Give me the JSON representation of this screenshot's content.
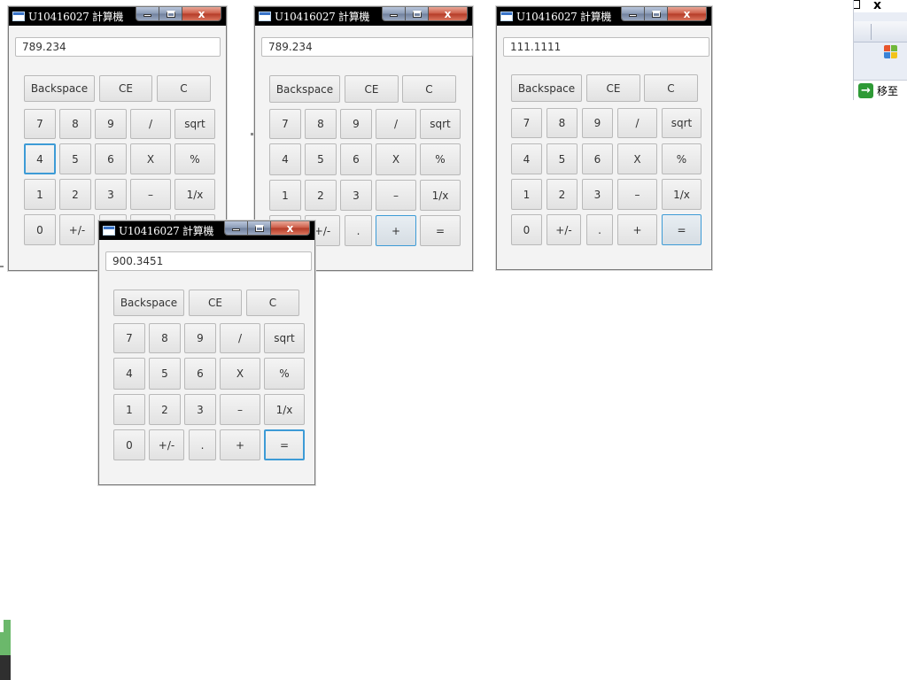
{
  "windows": [
    {
      "title": "U10416027 計算機",
      "display": "789.234",
      "buttons": {
        "backspace": "Backspace",
        "ce": "CE",
        "c": "C",
        "n7": "7",
        "n8": "8",
        "n9": "9",
        "div": "/",
        "sqrt": "sqrt",
        "n4": "4",
        "n5": "5",
        "n6": "6",
        "mul": "X",
        "pct": "%",
        "n1": "1",
        "n2": "2",
        "n3": "3",
        "sub": "–",
        "inv": "1/x",
        "n0": "0",
        "neg": "+/-"
      },
      "focused_button": "4"
    },
    {
      "title": "U10416027 計算機",
      "display": "789.234",
      "buttons": {
        "backspace": "Backspace",
        "ce": "CE",
        "c": "C",
        "n7": "7",
        "n8": "8",
        "n9": "9",
        "div": "/",
        "sqrt": "sqrt",
        "n4": "4",
        "n5": "5",
        "n6": "6",
        "mul": "X",
        "pct": "%",
        "n1": "1",
        "n2": "2",
        "n3": "3",
        "sub": "–",
        "inv": "1/x",
        "neg": "+/-",
        "dot": ".",
        "add": "+",
        "eq": "="
      },
      "focused_button": "+"
    },
    {
      "title": "U10416027 計算機",
      "display": "111.1111",
      "buttons": {
        "backspace": "Backspace",
        "ce": "CE",
        "c": "C",
        "n7": "7",
        "n8": "8",
        "n9": "9",
        "div": "/",
        "sqrt": "sqrt",
        "n4": "4",
        "n5": "5",
        "n6": "6",
        "mul": "X",
        "pct": "%",
        "n1": "1",
        "n2": "2",
        "n3": "3",
        "sub": "–",
        "inv": "1/x",
        "n0": "0",
        "neg": "+/-",
        "dot": ".",
        "add": "+",
        "eq": "="
      },
      "focused_button": "="
    },
    {
      "title": "U10416027 計算機",
      "display": "900.3451",
      "buttons": {
        "backspace": "Backspace",
        "ce": "CE",
        "c": "C",
        "n7": "7",
        "n8": "8",
        "n9": "9",
        "div": "/",
        "sqrt": "sqrt",
        "n4": "4",
        "n5": "5",
        "n6": "6",
        "mul": "X",
        "pct": "%",
        "n1": "1",
        "n2": "2",
        "n3": "3",
        "sub": "–",
        "inv": "1/x",
        "n0": "0",
        "neg": "+/-",
        "dot": ".",
        "add": "+",
        "eq": "="
      },
      "focused_button": "="
    }
  ],
  "window_controls": {
    "close_glyph": "x"
  },
  "side_window": {
    "close_glyph": "x",
    "go_label": "移至",
    "go_icon": "arrow-right-icon"
  },
  "colors": {
    "focus_ring": "#3d9bd6",
    "titlebar": "#000000",
    "close_red": "#cc5a45",
    "go_green": "#2e9a36"
  }
}
